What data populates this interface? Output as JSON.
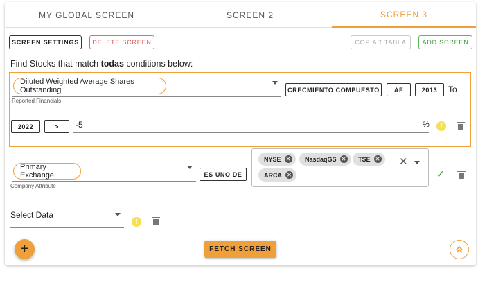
{
  "tabs": [
    {
      "label": "MY GLOBAL SCREEN",
      "active": false
    },
    {
      "label": "SCREEN 2",
      "active": false
    },
    {
      "label": "SCREEN 3",
      "active": true
    }
  ],
  "toolbar": {
    "screen_settings": "SCREEN SETTINGS",
    "delete_screen": "DELETE SCREEN",
    "copiar_tabla": "COPIAR TABLA",
    "add_screen": "ADD SCREEN"
  },
  "heading": {
    "prefix": "Find Stocks that match ",
    "emphasis": "todas",
    "suffix": " conditions below:"
  },
  "condition1": {
    "field": "Diluted Weighted Average Shares Outstanding",
    "field_category": "Reported Financials",
    "function": "CRECMIENTO COMPUESTO",
    "period": "AF",
    "from_year": "2013",
    "to_label": "To",
    "to_year": "2022",
    "operator": ">",
    "value": "-5",
    "unit": "%"
  },
  "condition2": {
    "field": "Primary Exchange",
    "field_category": "Company Attribute",
    "operator": "ES UNO DE",
    "chips": [
      "NYSE",
      "NasdaqGS",
      "TSE",
      "ARCA"
    ]
  },
  "condition3": {
    "placeholder": "Select Data"
  },
  "actions": {
    "add_icon": "plus-icon",
    "fetch": "FETCH SCREEN",
    "scroll_icon": "double-chevron-up-icon"
  },
  "colors": {
    "accent": "#f0a03a",
    "danger": "#d9534f",
    "success": "#3c9a3c",
    "warning": "#f5e05a"
  }
}
